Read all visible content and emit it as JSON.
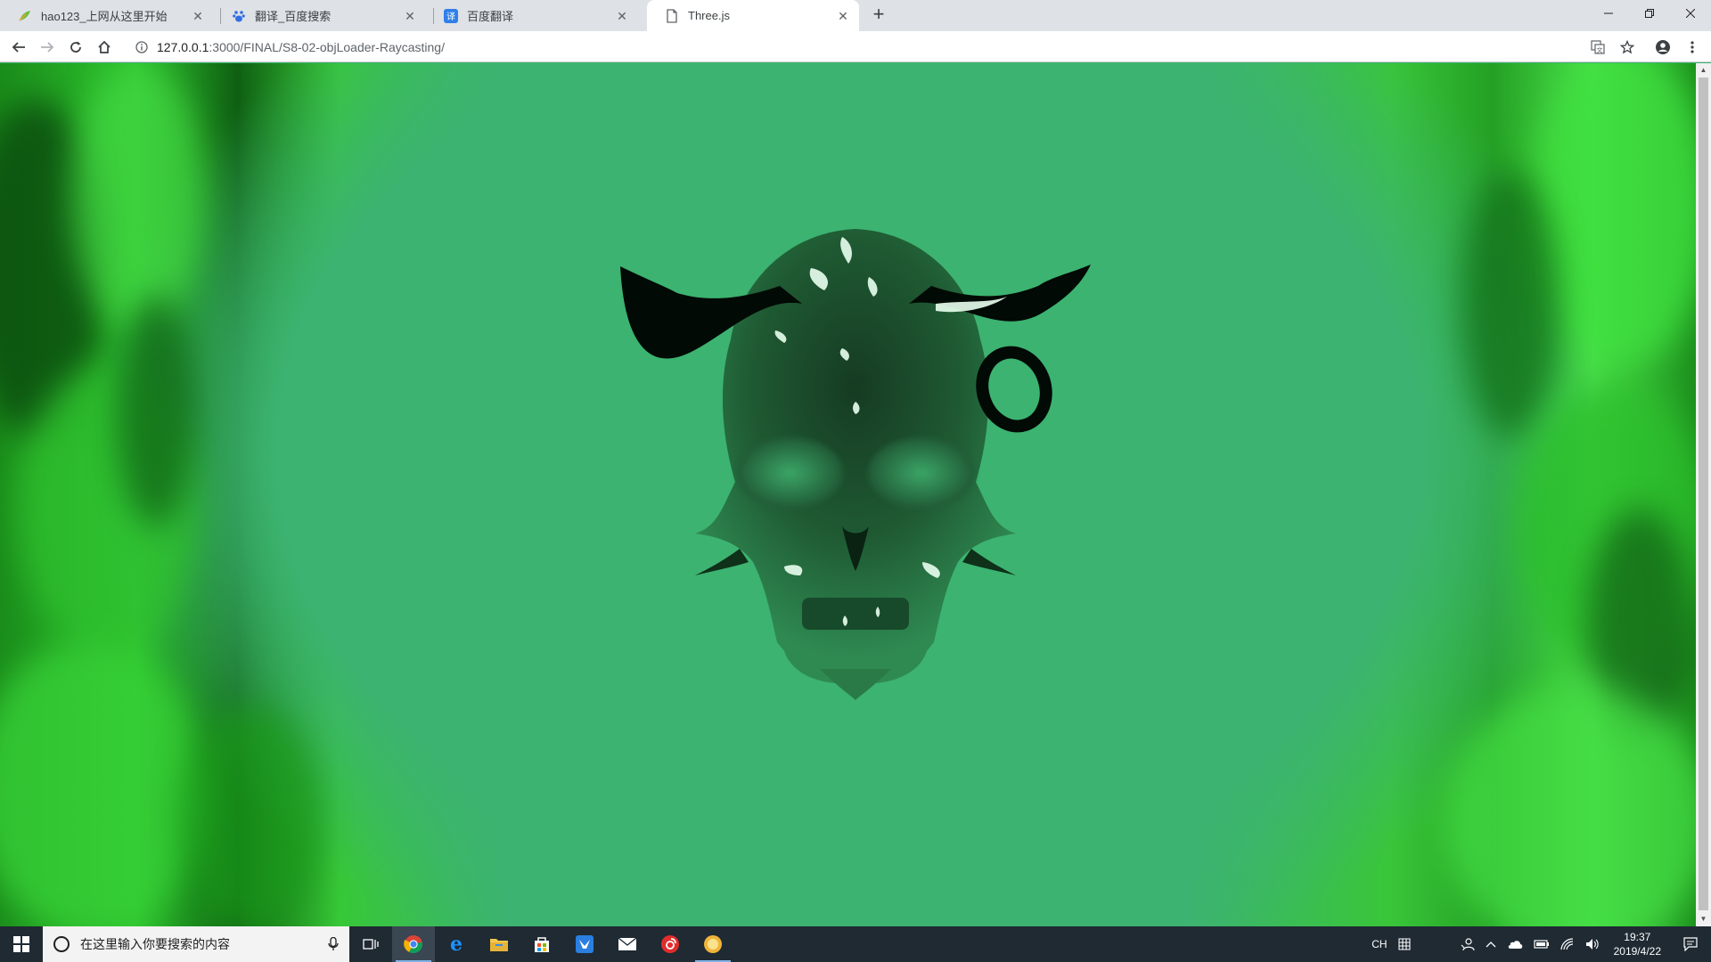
{
  "browser": {
    "tabs": [
      {
        "title": "hao123_上网从这里开始",
        "icon": "hao123-leaf-icon",
        "active": false
      },
      {
        "title": "翻译_百度搜索",
        "icon": "baidu-paw-icon",
        "active": false
      },
      {
        "title": "百度翻译",
        "icon": "baidu-translate-icon",
        "active": false
      },
      {
        "title": "Three.js",
        "icon": "document-icon",
        "active": true
      }
    ],
    "url_host": "127.0.0.1",
    "url_path": ":3000/FINAL/S8-02-objLoader-Raycasting/"
  },
  "taskbar": {
    "search_placeholder": "在这里输入你要搜索的内容",
    "apps": [
      "task-view-icon",
      "chrome-icon",
      "edge-icon",
      "file-explorer-icon",
      "store-icon",
      "feishu-icon",
      "mail-icon",
      "netease-music-icon",
      "sun-app-icon"
    ],
    "ime_label": "CH",
    "time": "19:37",
    "date": "2019/4/22"
  },
  "colors": {
    "scene_background": "#3cb371",
    "flame_green": "#2ec42e",
    "skull_dark": "#0b2a17"
  }
}
